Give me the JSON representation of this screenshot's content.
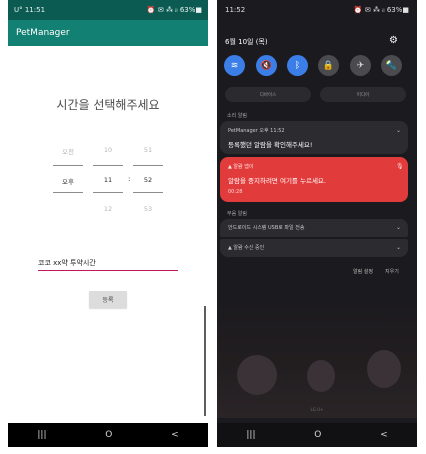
{
  "left_screen": {
    "status_bar": {
      "time": "U° 11:51",
      "icons": "⏰ ✉ ⁂ ᵢₗ 63%■"
    },
    "app_bar": {
      "title": "PetManager"
    },
    "time_title": "시간을 선택해주세요",
    "picker": {
      "ampm": {
        "above": "오전",
        "selected": "오후"
      },
      "hour": {
        "above": "10",
        "selected": "11",
        "below": "12"
      },
      "minute": {
        "above": "51",
        "selected": "52",
        "below": "53"
      },
      "separator": ":"
    },
    "name_input": {
      "value": "코코 xx약 투약시간"
    },
    "register_button": {
      "label": "등록"
    },
    "nav": {
      "recents": "|||",
      "home": "O",
      "back": "<"
    }
  },
  "right_screen": {
    "status_bar": {
      "time": "11:52",
      "icons": "⏰ ✉ ⁂ ᵢₗ 63%■"
    },
    "date": "6월 10일 (목)",
    "quick_settings": [
      {
        "icon": "wifi-icon",
        "glyph": "≋",
        "state": "on"
      },
      {
        "icon": "mute-icon",
        "glyph": "🔇",
        "state": "on"
      },
      {
        "icon": "bluetooth-icon",
        "glyph": "ᛒ",
        "state": "on"
      },
      {
        "icon": "lock-icon",
        "glyph": "🔒",
        "state": "off"
      },
      {
        "icon": "airplane-icon",
        "glyph": "✈",
        "state": "off"
      },
      {
        "icon": "flashlight-icon",
        "glyph": "🔦",
        "state": "off"
      }
    ],
    "media_buttons": {
      "left": "디바이스",
      "right": "미디어"
    },
    "sound_section_label": "소리 알림",
    "petmanager_notification": {
      "app_line": "PetManager  오후 11:52",
      "body": "등록했던 알람을 확인해주세요!"
    },
    "alarm_notification": {
      "app_line": "▲ 알람 앱이",
      "body": "알람을 중지하려면 여기를 누르세요.",
      "time": "00:28"
    },
    "silent_section_label": "무음 알림",
    "system_notification": {
      "body": "안드로이드 시스템 USB로 파일 전송"
    },
    "alarm_app_notification": {
      "body": "▲ 알람 수신 중인"
    },
    "footer_links": {
      "left": "알림 설정",
      "right": "지우기"
    },
    "brand_text": "LG U+",
    "nav": {
      "recents": "|||",
      "home": "O",
      "back": "<"
    }
  },
  "colors": {
    "app_bar": "#138074",
    "status_bar_left": "#0c5b52",
    "input_underline": "#c2185b",
    "quick_setting_on": "#3c7ee7",
    "alarm_card": "#e23b3b",
    "shade_bg": "#1b1a1e"
  }
}
